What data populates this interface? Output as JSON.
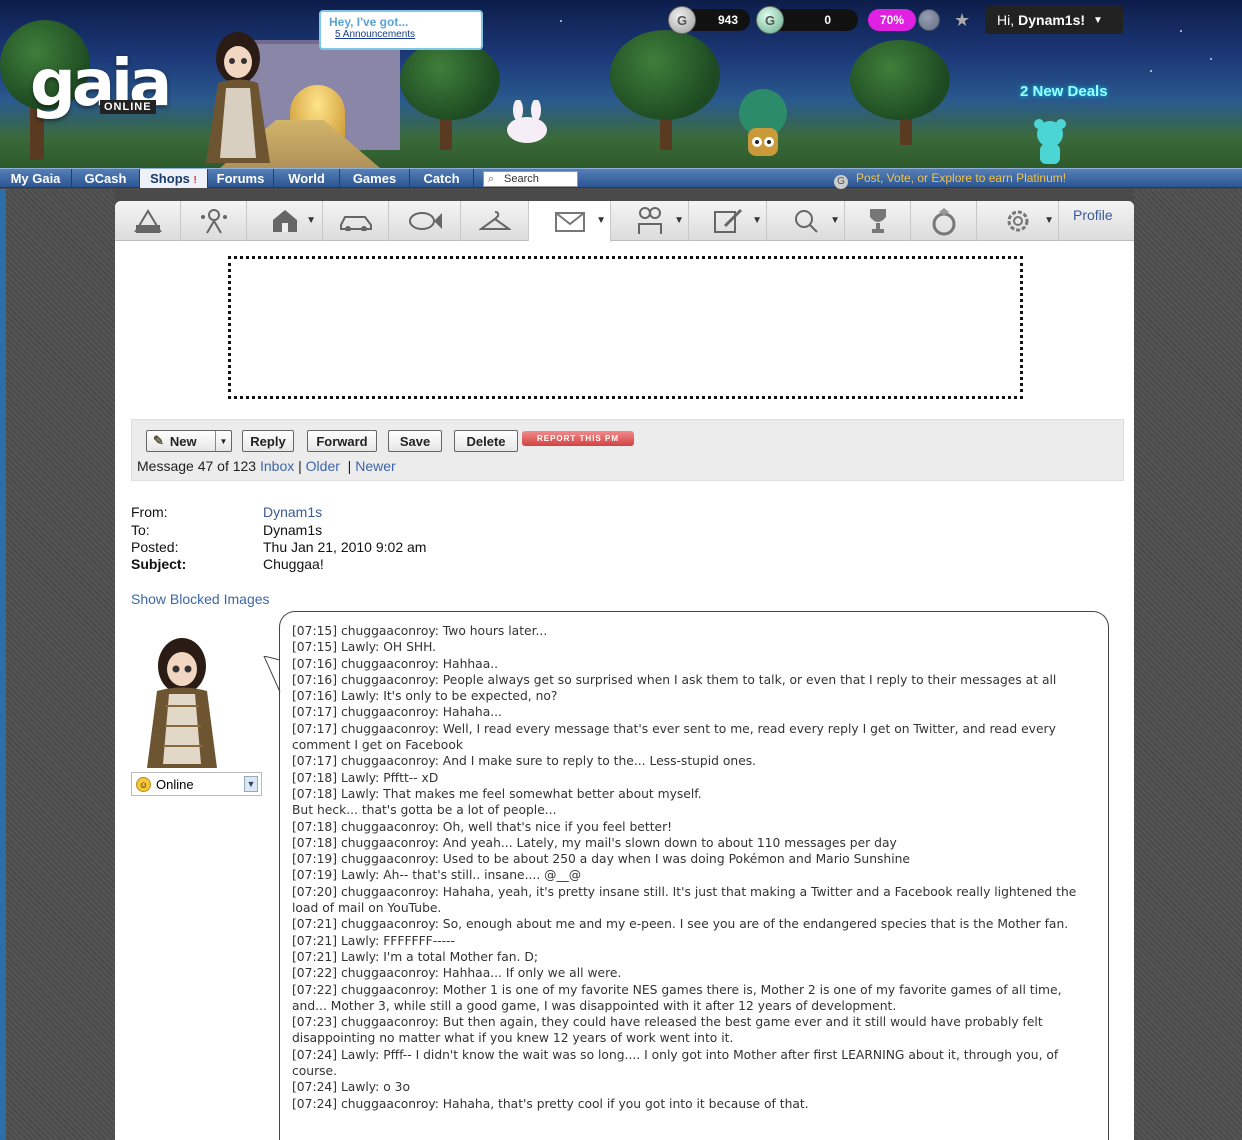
{
  "header": {
    "logo": "gaia",
    "logo_sub": "ONLINE",
    "notice_title": "Hey, I've got...",
    "notice_link": "5 Announcements",
    "gold": "943",
    "gcash": "0",
    "platinum_pct": "70%",
    "greeting_prefix": "Hi,",
    "username": "Dynam1s!",
    "deals": "2 New Deals"
  },
  "nav": {
    "items": [
      "My Gaia",
      "GCash",
      "Shops",
      "Forums",
      "World",
      "Games",
      "Catch"
    ],
    "search_placeholder": "Search",
    "promo": "Post, Vote, or Explore to earn Platinum!"
  },
  "toolbar": {
    "icons": [
      "gaia-icon",
      "avatar-icon",
      "house-icon",
      "car-icon",
      "fish-icon",
      "hanger-icon",
      "mail-icon",
      "friends-icon",
      "journal-icon",
      "search-icon",
      "trophy-icon",
      "ring-icon",
      "settings-icon"
    ],
    "profile_label": "Profile"
  },
  "actions": {
    "new": "New",
    "reply": "Reply",
    "forward": "Forward",
    "save": "Save",
    "delete": "Delete",
    "report": "REPORT THIS PM",
    "message_position": "Message 47 of 123",
    "inbox": "Inbox",
    "older": "Older",
    "newer": "Newer"
  },
  "message": {
    "from_label": "From:",
    "from": "Dynam1s",
    "to_label": "To:",
    "to": "Dynam1s",
    "posted_label": "Posted:",
    "posted": "Thu Jan 21, 2010 9:02 am",
    "subject_label": "Subject:",
    "subject": "Chuggaa!",
    "show_blocked": "Show Blocked Images",
    "status": "Online",
    "lines": [
      "[07:15] chuggaaconroy: Two hours later...",
      "[07:15] Lawly: OH SHH.",
      "[07:16] chuggaaconroy: Hahhaa..",
      "[07:16] chuggaaconroy: People always get so surprised when I ask them to talk, or even that I reply to their messages at all",
      "[07:16] Lawly: It's only to be expected, no?",
      "[07:17] chuggaaconroy: Hahaha...",
      "[07:17] chuggaaconroy: Well, I read every message that's ever sent to me, read every reply I get on Twitter, and read every comment I get on Facebook",
      "[07:17] chuggaaconroy: And I make sure to reply to the... Less-stupid ones.",
      "[07:18] Lawly: Pfftt-- xD",
      "[07:18] Lawly: That makes me feel somewhat better about myself.",
      "But heck... that's gotta be a lot of people...",
      "[07:18] chuggaaconroy: Oh, well that's nice if you feel better!",
      "[07:18] chuggaaconroy: And yeah... Lately, my mail's slown down to about 110 messages per day",
      "[07:19] chuggaaconroy: Used to be about 250 a day when I was doing Pokémon and Mario Sunshine",
      "[07:19] Lawly: Ah-- that's still.. insane.... @__@",
      "[07:20] chuggaaconroy: Hahaha, yeah, it's pretty insane still. It's just that making a Twitter and a Facebook really lightened the load of mail on YouTube.",
      "[07:21] chuggaaconroy: So, enough about me and my e-peen. I see you are of the endangered species that is the Mother fan.",
      "[07:21] Lawly: FFFFFFF-----",
      "[07:21] Lawly: I'm a total Mother fan. D;",
      "[07:22] chuggaaconroy: Hahhaa... If only we all were.",
      "[07:22] chuggaaconroy: Mother 1 is one of my favorite NES games there is, Mother 2 is one of my favorite games of all time, and... Mother 3, while still a good game, I was disappointed with it after 12 years of development.",
      "[07:23] chuggaaconroy: But then again, they could have released the best game ever and it still would have probably felt disappointing no matter what if you knew 12 years of work went into it.",
      "[07:24] Lawly: Pfff-- I didn't know the wait was so long.... I only got into Mother after first LEARNING about it, through you, of course.",
      "[07:24] Lawly: o 3o",
      "[07:24] chuggaaconroy: Hahaha, that's pretty cool if you got into it because of that."
    ]
  },
  "colors": {
    "nav_bg": "#2c5694",
    "link": "#3d66a8",
    "report_button": "#d34242",
    "platinum": "#e020e0"
  }
}
